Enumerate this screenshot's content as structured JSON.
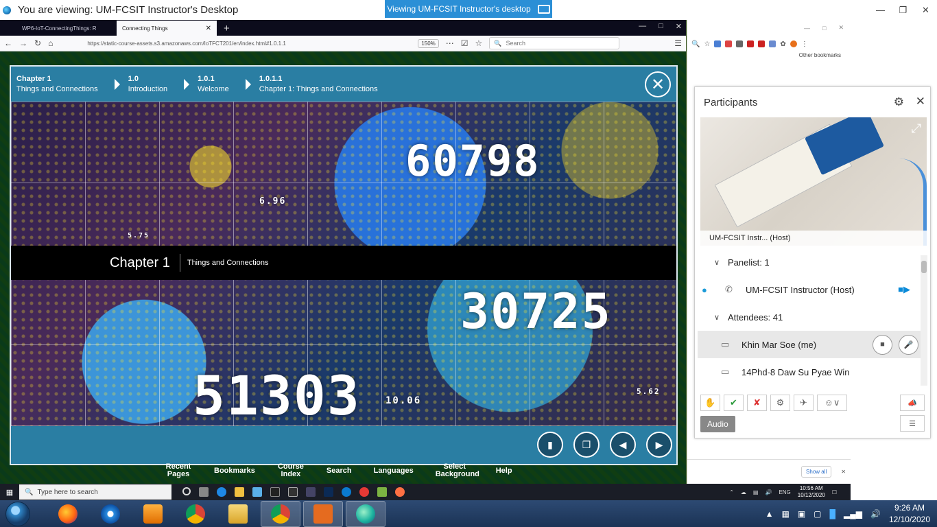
{
  "window": {
    "title": "You are viewing: UM-FCSIT Instructor's Desktop",
    "sharing_banner": "Viewing UM-FCSIT Instructor's desktop"
  },
  "browser": {
    "tabs": [
      {
        "label": "WP6-IoT-ConnectingThings: R"
      },
      {
        "label": "Connecting Things"
      }
    ],
    "url": "https://static-course-assets.s3.amazonaws.com/IoTFCT201/en/index.html#1.0.1.1",
    "zoom": "150%",
    "search_placeholder": "Search"
  },
  "course": {
    "breadcrumbs": [
      {
        "num": "Chapter 1",
        "label": "Things and Connections"
      },
      {
        "num": "1.0",
        "label": "Introduction"
      },
      {
        "num": "1.0.1",
        "label": "Welcome"
      },
      {
        "num": "1.0.1.1",
        "label": "Chapter 1: Things and Connections"
      }
    ],
    "chapter_band": {
      "num": "Chapter 1",
      "title": "Things and Connections"
    },
    "art_numbers": [
      "60798",
      "30725",
      "51303",
      "6.96",
      "5.75",
      "10.06",
      "5.62"
    ],
    "menu": [
      {
        "label": "Recent Pages"
      },
      {
        "label": "Bookmarks"
      },
      {
        "label": "Course Index"
      },
      {
        "label": "Search"
      },
      {
        "label": "Languages"
      },
      {
        "label": "Select Background"
      },
      {
        "label": "Help"
      }
    ]
  },
  "chrome": {
    "bookmark_label": "Other bookmarks",
    "show_all": "Show all"
  },
  "participants": {
    "title": "Participants",
    "video_label": "UM-FCSIT Instr...  (Host)",
    "panelist_header": "Panelist: 1",
    "panelist_name": "UM-FCSIT Instructor (Host)",
    "attendee_header": "Attendees: 41",
    "attendees": [
      {
        "name": "Khin Mar Soe (me)"
      },
      {
        "name": "14Phd-8 Daw Su Pyae Win"
      }
    ],
    "audio_button": "Audio"
  },
  "inner_taskbar": {
    "search_placeholder": "Type here to search",
    "lang": "ENG",
    "time": "10:56 AM",
    "date": "10/12/2020"
  },
  "taskbar": {
    "time": "9:26 AM",
    "date": "12/10/2020"
  },
  "colors": {
    "course_blue": "#2a7ea3",
    "banner_blue": "#2b8fd6",
    "video_icon_blue": "#0a8ad8"
  }
}
